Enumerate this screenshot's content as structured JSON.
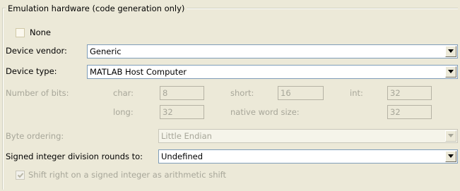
{
  "group": {
    "title": "Emulation hardware (code generation only)"
  },
  "none_checkbox": {
    "label": "None",
    "checked": false
  },
  "device_vendor": {
    "label": "Device vendor:",
    "value": "Generic"
  },
  "device_type": {
    "label": "Device type:",
    "value": "MATLAB Host Computer"
  },
  "bits": {
    "label": "Number of bits:",
    "char": {
      "label": "char:",
      "value": "8"
    },
    "short": {
      "label": "short:",
      "value": "16"
    },
    "int": {
      "label": "int:",
      "value": "32"
    },
    "long": {
      "label": "long:",
      "value": "32"
    },
    "native": {
      "label": "native word size:",
      "value": "32"
    }
  },
  "byte_ordering": {
    "label": "Byte ordering:",
    "value": "Little Endian"
  },
  "signed_division": {
    "label": "Signed integer division rounds to:",
    "value": "Undefined"
  },
  "shift_right": {
    "label": "Shift right on a signed integer as arithmetic shift",
    "checked": true
  },
  "icons": {
    "dropdown": "chevron-down-icon",
    "check": "checkmark-icon"
  }
}
